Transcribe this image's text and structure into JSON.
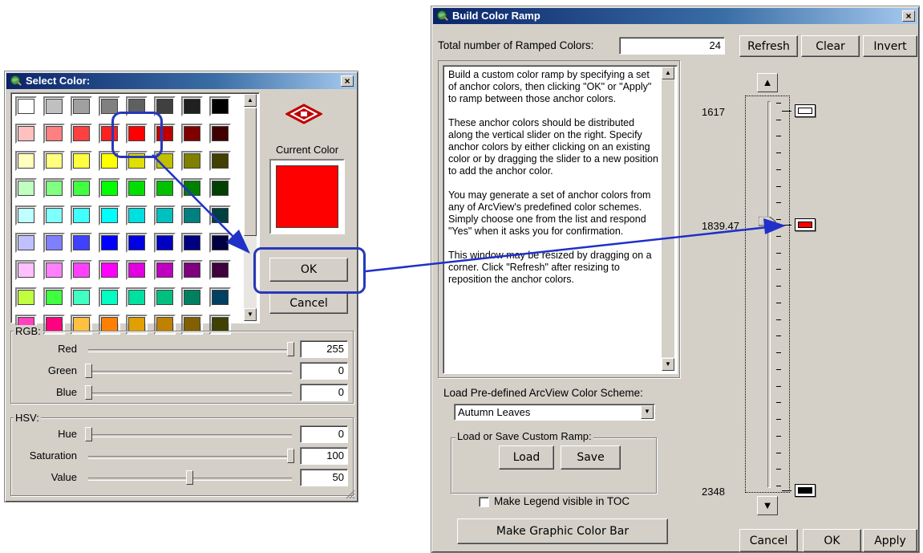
{
  "select_color": {
    "title": "Select Color:",
    "close": "×",
    "current_color_label": "Current Color",
    "current_color": "#ff0000",
    "ok": "OK",
    "cancel": "Cancel",
    "palette": [
      [
        "#ffffff",
        "#c0c0c0",
        "#a0a0a0",
        "#808080",
        "#606060",
        "#404040",
        "#202020",
        "#000000"
      ],
      [
        "#ffc0c0",
        "#ff8080",
        "#ff4040",
        "#ff2020",
        "#ff0000",
        "#c00000",
        "#800000",
        "#400000"
      ],
      [
        "#ffffc0",
        "#ffff80",
        "#ffff40",
        "#ffff00",
        "#e0e000",
        "#c0c000",
        "#808000",
        "#404000"
      ],
      [
        "#c0ffc0",
        "#80ff80",
        "#40ff40",
        "#00ff00",
        "#00e000",
        "#00c000",
        "#008000",
        "#004000"
      ],
      [
        "#c0ffff",
        "#80ffff",
        "#40ffff",
        "#00ffff",
        "#00e0e0",
        "#00c0c0",
        "#008080",
        "#004040"
      ],
      [
        "#c0c0ff",
        "#8080ff",
        "#4040ff",
        "#0000ff",
        "#0000e0",
        "#0000c0",
        "#000080",
        "#000040"
      ],
      [
        "#ffc0ff",
        "#ff80ff",
        "#ff40ff",
        "#ff00ff",
        "#e000e0",
        "#c000c0",
        "#800080",
        "#400040"
      ],
      [
        "#c0ff40",
        "#40ff40",
        "#40ffc0",
        "#00ffc0",
        "#00e0a0",
        "#00c080",
        "#008060",
        "#004060"
      ],
      [
        "#ff40c0",
        "#ff0080",
        "#ffc040",
        "#ff8000",
        "#e0a000",
        "#c08000",
        "#806000",
        "#404000"
      ]
    ],
    "rgb_label": "RGB:",
    "hsv_label": "HSV:",
    "rgb": [
      {
        "label": "Red",
        "value": "255",
        "level": 1.0
      },
      {
        "label": "Green",
        "value": "0",
        "level": 0.0
      },
      {
        "label": "Blue",
        "value": "0",
        "level": 0.0
      }
    ],
    "hsv": [
      {
        "label": "Hue",
        "value": "0",
        "level": 0.0
      },
      {
        "label": "Saturation",
        "value": "100",
        "level": 1.0
      },
      {
        "label": "Value",
        "value": "50",
        "level": 0.5
      }
    ]
  },
  "build_ramp": {
    "title": "Build Color Ramp",
    "close": "×",
    "total_label": "Total number of Ramped Colors:",
    "total_value": "24",
    "refresh": "Refresh",
    "clear": "Clear",
    "invert": "Invert",
    "info_text": "Build a custom color ramp by specifying a set of anchor colors, then clicking \"OK\" or \"Apply\" to ramp between those anchor colors.\n\nThese anchor colors should be distributed along the vertical slider on the right.  Specify anchor colors by either clicking on an existing color or by dragging the slider to a new position to add the anchor color.\n\nYou may generate a set of anchor colors from any of ArcView's predefined color schemes.  Simply choose one from the list and respond \"Yes\" when it asks you for confirmation.\n\nThis window may be resized by dragging on a corner.  Click \"Refresh\" after resizing to reposition the anchor colors.",
    "scheme_label": "Load Pre-defined ArcView Color Scheme:",
    "scheme_value": "Autumn Leaves",
    "custom_label": "Load or Save Custom Ramp:",
    "load": "Load",
    "save": "Save",
    "legend_label": "Make Legend visible in TOC",
    "legend_checked": false,
    "graphic_bar": "Make Graphic Color Bar",
    "cancel": "Cancel",
    "ok": "OK",
    "apply": "Apply",
    "anchors": [
      {
        "value": "1617",
        "color": "#ffffff",
        "level": 0.0
      },
      {
        "value": "1839.47",
        "color": "#ff0000",
        "level": 0.3
      },
      {
        "value": "2348",
        "color": "#000000",
        "level": 1.0
      }
    ]
  }
}
